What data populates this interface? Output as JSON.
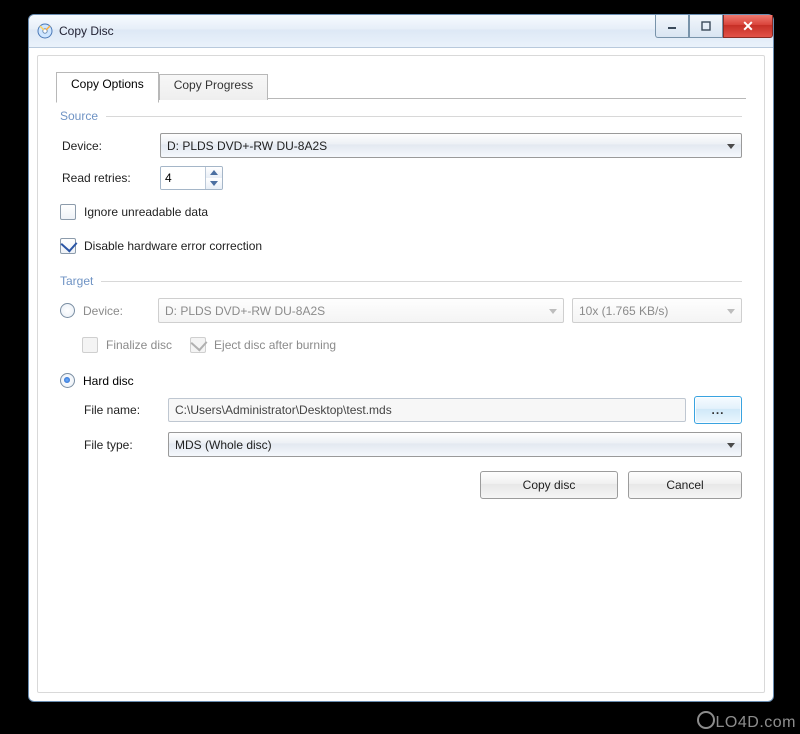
{
  "window": {
    "title": "Copy Disc"
  },
  "tabs": [
    {
      "label": "Copy Options"
    },
    {
      "label": "Copy Progress"
    }
  ],
  "source": {
    "heading": "Source",
    "device_label": "Device:",
    "device_value": "D: PLDS DVD+-RW DU-8A2S",
    "retries_label": "Read retries:",
    "retries_value": "4",
    "ignore_label": "Ignore unreadable data",
    "disable_ecc_label": "Disable hardware error correction"
  },
  "target": {
    "heading": "Target",
    "device_label": "Device:",
    "device_value": "D: PLDS DVD+-RW DU-8A2S",
    "speed_value": "10x (1.765 KB/s)",
    "finalize_label": "Finalize disc",
    "eject_label": "Eject disc after burning",
    "harddisc_label": "Hard disc",
    "filename_label": "File name:",
    "filename_value": "C:\\Users\\Administrator\\Desktop\\test.mds",
    "browse_label": "...",
    "filetype_label": "File type:",
    "filetype_value": "MDS (Whole disc)"
  },
  "footer": {
    "copy_label": "Copy disc",
    "cancel_label": "Cancel"
  },
  "watermark": "LO4D.com"
}
